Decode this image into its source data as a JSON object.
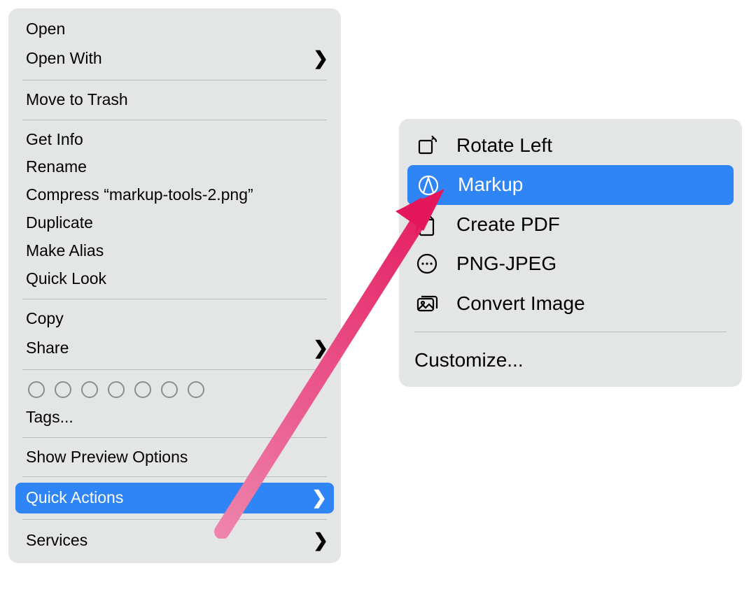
{
  "main_menu": {
    "open": "Open",
    "open_with": "Open With",
    "move_to_trash": "Move to Trash",
    "get_info": "Get Info",
    "rename": "Rename",
    "compress": "Compress “markup-tools-2.png”",
    "duplicate": "Duplicate",
    "make_alias": "Make Alias",
    "quick_look": "Quick Look",
    "copy": "Copy",
    "share": "Share",
    "tags": "Tags...",
    "show_preview_options": "Show Preview Options",
    "quick_actions": "Quick Actions",
    "services": "Services"
  },
  "sub_menu": {
    "rotate_left": "Rotate Left",
    "markup": "Markup",
    "create_pdf": "Create PDF",
    "png_jpeg": "PNG-JPEG",
    "convert_image": "Convert Image",
    "customize": "Customize..."
  },
  "colors": {
    "highlight": "#2f84f6",
    "panel": "#e3e6e5",
    "arrow_start": "#ee86ae",
    "arrow_end": "#e4175d"
  }
}
